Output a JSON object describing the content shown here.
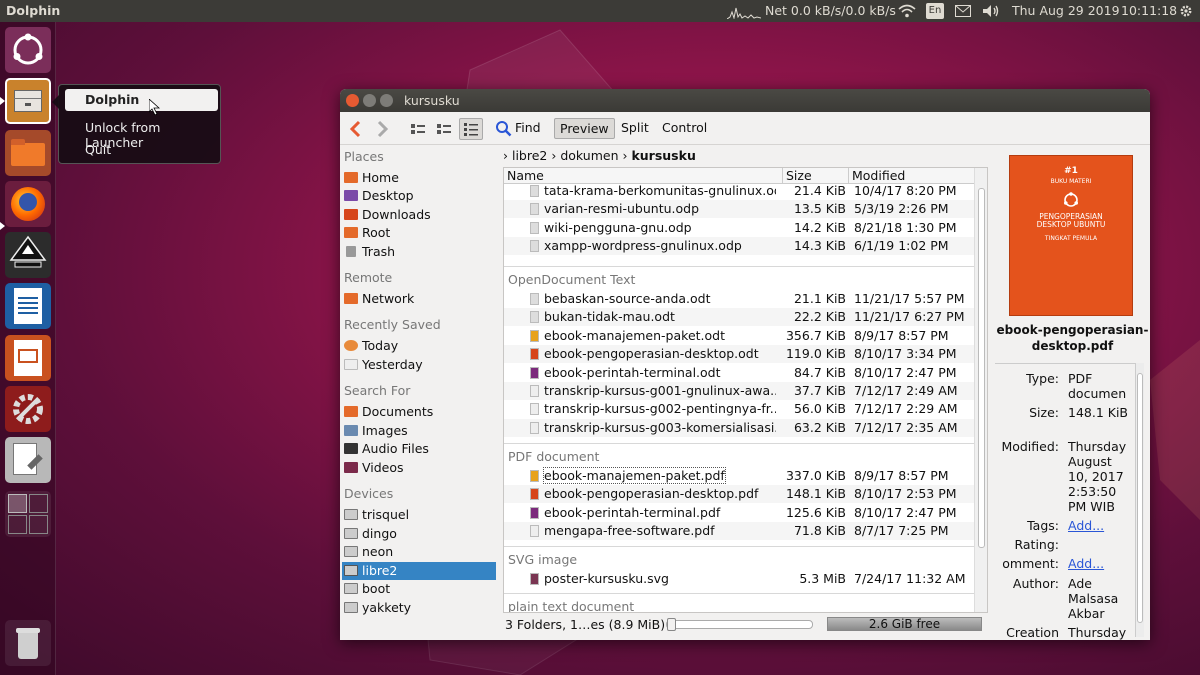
{
  "topbar": {
    "app_name": "Dolphin",
    "net": "Net 0.0 kB/s/0.0 kB/s",
    "keyboard": "En",
    "date": "Thu Aug 29 2019",
    "time": "10:11:18"
  },
  "quicklist": {
    "items": [
      "Dolphin",
      "Unlock from Launcher",
      "Quit"
    ]
  },
  "window": {
    "title": "kursusku",
    "toolbar": {
      "find": "Find",
      "preview": "Preview",
      "split": "Split",
      "control": "Control"
    },
    "places": {
      "heading_places": "Places",
      "places": [
        "Home",
        "Desktop",
        "Downloads",
        "Root",
        "Trash"
      ],
      "heading_remote": "Remote",
      "remote": [
        "Network"
      ],
      "heading_recent": "Recently Saved",
      "recent": [
        "Today",
        "Yesterday"
      ],
      "heading_search": "Search For",
      "search": [
        "Documents",
        "Images",
        "Audio Files",
        "Videos"
      ],
      "heading_devices": "Devices",
      "devices": [
        "trisquel",
        "dingo",
        "neon",
        "libre2",
        "boot",
        "yakkety"
      ],
      "selected_device": "libre2"
    },
    "breadcrumb": [
      "libre2",
      "dokumen",
      "kursusku"
    ],
    "columns": [
      "Name",
      "Size",
      "Modified"
    ],
    "groups": [
      {
        "label": "",
        "files": [
          {
            "name": "tata-krama-berkomunitas-gnulinux.odp",
            "size": "21.4 KiB",
            "modified": "10/4/17 8:20 PM",
            "color": "#dddddd"
          },
          {
            "name": "varian-resmi-ubuntu.odp",
            "size": "13.5 KiB",
            "modified": "5/3/19 2:26 PM",
            "color": "#dddddd"
          },
          {
            "name": "wiki-pengguna-gnu.odp",
            "size": "14.2 KiB",
            "modified": "8/21/18 1:30 PM",
            "color": "#dddddd"
          },
          {
            "name": "xampp-wordpress-gnulinux.odp",
            "size": "14.3 KiB",
            "modified": "6/1/19 1:02 PM",
            "color": "#dddddd"
          }
        ]
      },
      {
        "label": "OpenDocument Text",
        "files": [
          {
            "name": "bebaskan-source-anda.odt",
            "size": "21.1 KiB",
            "modified": "11/21/17 5:57 PM",
            "color": "#dddddd"
          },
          {
            "name": "bukan-tidak-mau.odt",
            "size": "22.2 KiB",
            "modified": "11/21/17 6:27 PM",
            "color": "#dddddd"
          },
          {
            "name": "ebook-manajemen-paket.odt",
            "size": "356.7 KiB",
            "modified": "8/9/17 8:57 PM",
            "color": "#e8a21c"
          },
          {
            "name": "ebook-pengoperasian-desktop.odt",
            "size": "119.0 KiB",
            "modified": "8/10/17 3:34 PM",
            "color": "#d6461c"
          },
          {
            "name": "ebook-perintah-terminal.odt",
            "size": "84.7 KiB",
            "modified": "8/10/17 2:47 PM",
            "color": "#7b2a7b"
          },
          {
            "name": "transkrip-kursus-g001-gnulinux-awa...",
            "size": "37.7 KiB",
            "modified": "7/12/17 2:49 AM",
            "color": "#eeeeee"
          },
          {
            "name": "transkrip-kursus-g002-pentingnya-fr...",
            "size": "56.0 KiB",
            "modified": "7/12/17 2:29 AM",
            "color": "#eeeeee"
          },
          {
            "name": "transkrip-kursus-g003-komersialisasi...",
            "size": "63.2 KiB",
            "modified": "7/12/17 2:35 AM",
            "color": "#eeeeee"
          }
        ]
      },
      {
        "label": "PDF document",
        "files": [
          {
            "name": "ebook-manajemen-paket.pdf",
            "size": "337.0 KiB",
            "modified": "8/9/17 8:57 PM",
            "color": "#e8a21c"
          },
          {
            "name": "ebook-pengoperasian-desktop.pdf",
            "size": "148.1 KiB",
            "modified": "8/10/17 2:53 PM",
            "color": "#d6461c"
          },
          {
            "name": "ebook-perintah-terminal.pdf",
            "size": "125.6 KiB",
            "modified": "8/10/17 2:47 PM",
            "color": "#7b2a7b"
          },
          {
            "name": "mengapa-free-software.pdf",
            "size": "71.8 KiB",
            "modified": "8/7/17 7:25 PM",
            "color": "#eeeeee"
          }
        ]
      },
      {
        "label": "SVG image",
        "files": [
          {
            "name": "poster-kursusku.svg",
            "size": "5.3 MiB",
            "modified": "7/24/17 11:32 AM",
            "color": "#7a3552"
          }
        ]
      },
      {
        "label": "plain text document",
        "files": []
      }
    ],
    "status": {
      "summary": "3 Folders, 1…es (8.9 MiB)",
      "free": "2.6 GiB free"
    },
    "info": {
      "cover_number": "#1",
      "cover_top": "BUKU MATERI",
      "cover_title": "PENGOPERASIAN DESKTOP UBUNTU",
      "cover_sub": "TINGKAT PEMULA",
      "filename": "ebook-pengoperasian-desktop.pdf",
      "type_label": "Type:",
      "type_value": "PDF documen",
      "size_label": "Size:",
      "size_value": "148.1 KiB",
      "modified_label": "Modified:",
      "modified_value": "Thursday August 10, 2017 2:53:50 PM WIB",
      "tags_label": "Tags:",
      "tags_value": "Add...",
      "rating_label": "Rating:",
      "comment_label": "omment:",
      "comment_value": "Add...",
      "author_label": "Author:",
      "author_value": "Ade Malsasa Akbar",
      "creation_label": "Creation",
      "creation_value": "Thursday"
    }
  }
}
